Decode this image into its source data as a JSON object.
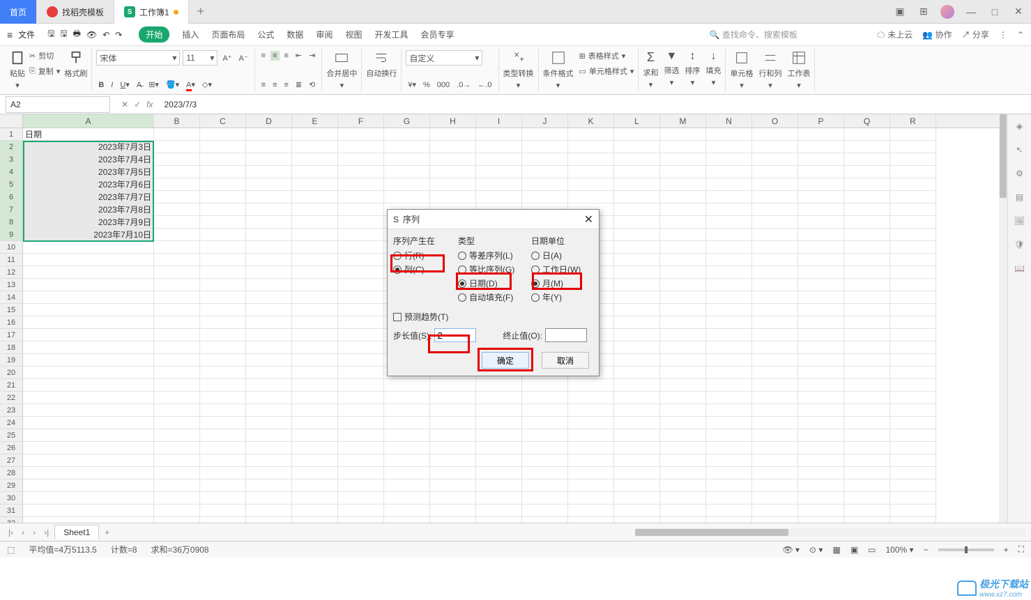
{
  "tabs": {
    "home": "首页",
    "template": "找稻壳模板",
    "workbook": "工作簿1"
  },
  "menu": {
    "file": "文件",
    "items": [
      "开始",
      "插入",
      "页面布局",
      "公式",
      "数据",
      "审阅",
      "视图",
      "开发工具",
      "会员专享"
    ],
    "search_ph": "查找命令、搜索模板",
    "cloud": "未上云",
    "collab": "协作",
    "share": "分享"
  },
  "toolbar": {
    "paste": "粘贴",
    "cut": "剪切",
    "copy": "复制",
    "format_painter": "格式刷",
    "font": "宋体",
    "size": "11",
    "merge": "合并居中",
    "wrap": "自动换行",
    "numfmt": "自定义",
    "type_convert": "类型转换",
    "cond_fmt": "条件格式",
    "table_style": "表格样式",
    "cell_style": "单元格样式",
    "sum": "求和",
    "filter": "筛选",
    "sort": "排序",
    "fill": "填充",
    "cells": "单元格",
    "rowcol": "行和列",
    "sheet": "工作表"
  },
  "namebox": "A2",
  "formula": "2023/7/3",
  "cols": [
    "A",
    "B",
    "C",
    "D",
    "E",
    "F",
    "G",
    "H",
    "I",
    "J",
    "K",
    "L",
    "M",
    "N",
    "O",
    "P",
    "Q",
    "R"
  ],
  "rows": 33,
  "colA": {
    "header": "日期",
    "data": [
      "2023年7月3日",
      "2023年7月4日",
      "2023年7月5日",
      "2023年7月6日",
      "2023年7月7日",
      "2023年7月8日",
      "2023年7月9日",
      "2023年7月10日"
    ]
  },
  "dialog": {
    "title": "序列",
    "close": "✕",
    "group_in": "序列产生在",
    "row": "行(R)",
    "col": "列(C)",
    "group_type": "类型",
    "arith": "等差序列(L)",
    "geom": "等比序列(G)",
    "date": "日期(D)",
    "autofill": "自动填充(F)",
    "group_unit": "日期单位",
    "day": "日(A)",
    "workday": "工作日(W)",
    "month": "月(M)",
    "year": "年(Y)",
    "trend": "预测趋势(T)",
    "step_label": "步长值(S):",
    "step_value": "2",
    "end_label": "终止值(O):",
    "end_value": "",
    "ok": "确定",
    "cancel": "取消"
  },
  "sheets": {
    "sheet1": "Sheet1"
  },
  "status": {
    "avg": "平均值=4万5113.5",
    "count": "计数=8",
    "sum": "求和=36万0908",
    "zoom": "100%"
  },
  "watermark": {
    "brand": "极光下载站",
    "url": "www.xz7.com"
  }
}
